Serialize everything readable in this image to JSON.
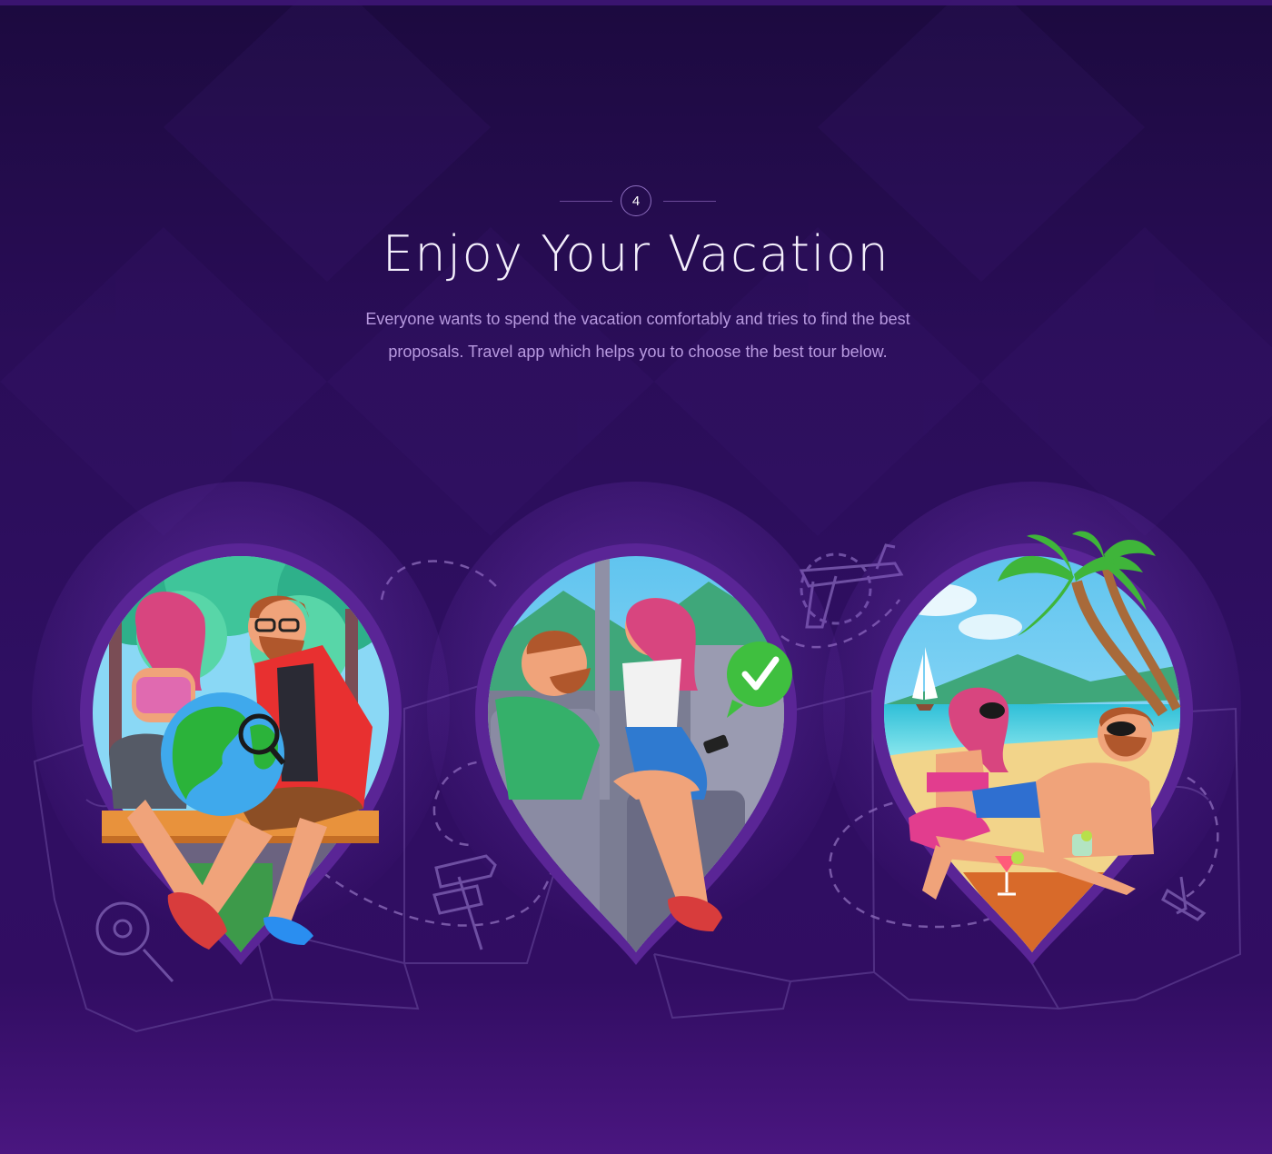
{
  "step": {
    "number": "4"
  },
  "heading": {
    "title": "Enjoy Your Vacation"
  },
  "intro": {
    "line1": "Everyone wants to spend the vacation comfortably and tries to find the best",
    "line2": "proposals. Travel app which helps you to choose the best tour below."
  },
  "colors": {
    "background": "#2a0d58",
    "accent_purple": "#6a2fb0",
    "title_text": "#f4effc",
    "body_text": "#b89ae0",
    "check_green": "#3fbf3f"
  },
  "scenes": [
    {
      "icon": "globe-planning-scene"
    },
    {
      "icon": "bus-travel-scene"
    },
    {
      "icon": "beach-relax-scene"
    }
  ]
}
